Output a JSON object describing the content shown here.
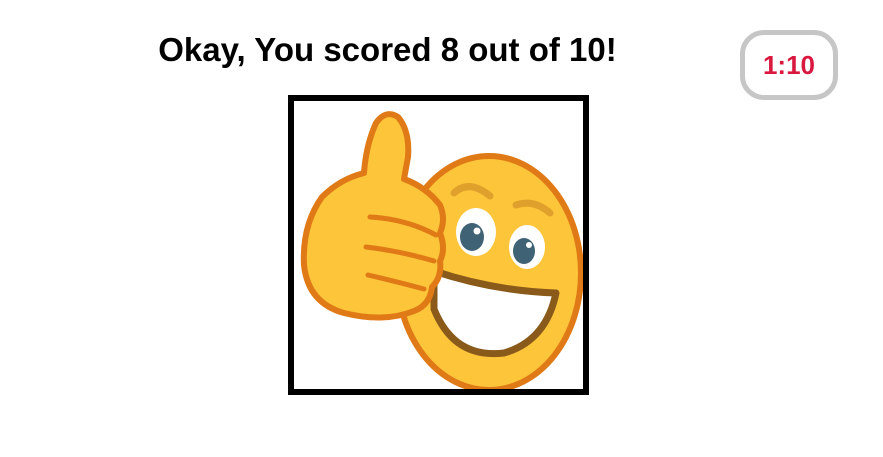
{
  "result": {
    "title": "Okay, You scored 8 out of 10!"
  },
  "timer": {
    "value": "1:10"
  },
  "image": {
    "icon": "thumbs-up-smiley-icon"
  },
  "colors": {
    "timer_text": "#d8183f",
    "timer_border": "#c6c6c6",
    "frame_border": "#000000",
    "emoji_fill": "#fdc53a",
    "emoji_outline": "#e07a16"
  }
}
